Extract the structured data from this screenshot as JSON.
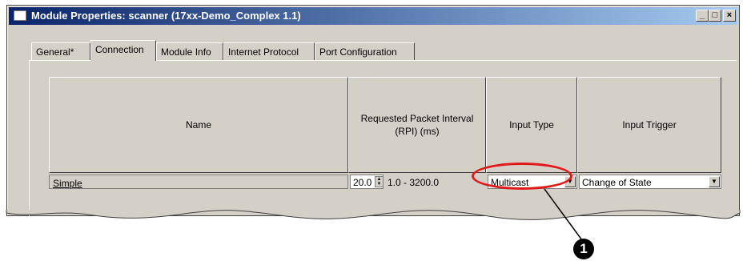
{
  "window": {
    "title": "Module Properties: scanner (17xx-Demo_Complex 1.1)",
    "controls": {
      "minimize": "_",
      "maximize": "□",
      "close": "×"
    }
  },
  "tabs": [
    {
      "label": "General*",
      "active": false
    },
    {
      "label": "Connection",
      "active": true
    },
    {
      "label": "Module Info",
      "active": false
    },
    {
      "label": "Internet Protocol",
      "active": false
    },
    {
      "label": "Port Configuration",
      "active": false
    }
  ],
  "table": {
    "headers": {
      "name": "Name",
      "rpi_line1": "Requested Packet Interval",
      "rpi_line2": "(RPI) (ms)",
      "input_type": "Input Type",
      "input_trigger": "Input Trigger"
    },
    "row": {
      "name": "Simple",
      "rpi_value": "20.0",
      "rpi_range": "1.0 - 3200.0",
      "input_type": "Multicast",
      "input_trigger": "Change of State"
    }
  },
  "callout": {
    "number": "1",
    "color": "#e0191b"
  },
  "colors": {
    "dialog_bg": "#d4d0c8",
    "title_start": "#0a246a",
    "title_end": "#a6caf0"
  }
}
